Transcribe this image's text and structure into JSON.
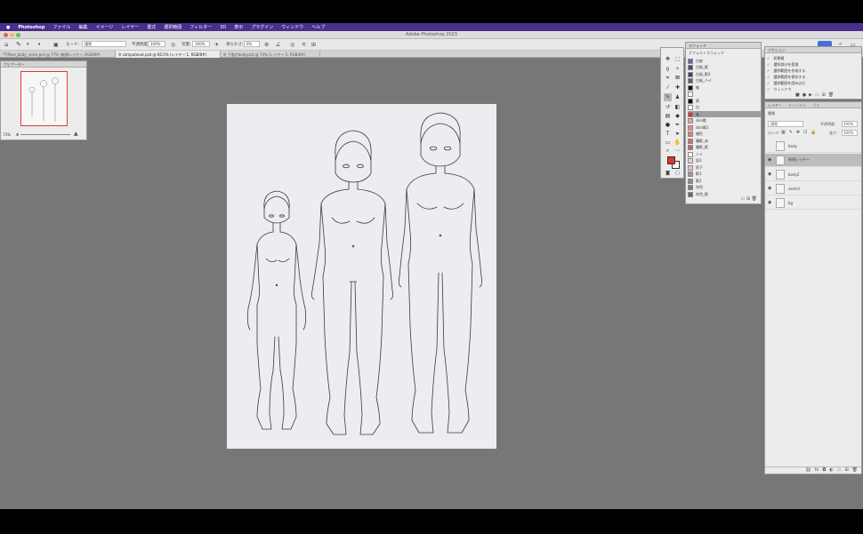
{
  "menubar": {
    "app_name": "Photoshop",
    "items": [
      "ファイル",
      "編集",
      "イメージ",
      "レイヤー",
      "書式",
      "選択範囲",
      "フィルター",
      "3D",
      "表示",
      "プラグイン",
      "ウィンドウ",
      "ヘルプ"
    ]
  },
  "window": {
    "title": "Adobe Photoshop 2023"
  },
  "options": {
    "mode_label": "モード:",
    "mode_value": "通常",
    "opacity_label": "不透明度:",
    "opacity_value": "100%",
    "flow_label": "流量:",
    "flow_value": "100%",
    "smoothing_label": "滑らかさ:",
    "smoothing_value": "0%"
  },
  "tabs": [
    {
      "label": "*T-Pose_body_noise.psd @ 77% (新規レイヤー, RGB/8#)"
    },
    {
      "label": "※ computeout.psd @ 66.5% (レイヤー 1, RGB/8#)"
    },
    {
      "label": "※ 下描きbody.psd @ 73% (レイヤー 1, RGB/8#)"
    }
  ],
  "navigator": {
    "header": "ナビゲーター",
    "zoom": "73%"
  },
  "swatches": {
    "header": "スウォッチ",
    "subheader": "デフォルトスウォッチ",
    "items": [
      {
        "name": "白桜",
        "color": "#6e6a9e"
      },
      {
        "name": "白桜_影",
        "color": "#4d4a7a"
      },
      {
        "name": "白桜_影2",
        "color": "#444466"
      },
      {
        "name": "白桜_ハイ",
        "color": "#5a5a84"
      },
      {
        "name": "線",
        "color": "#111111"
      },
      {
        "name": "",
        "color": "#ffffff"
      },
      {
        "name": "黒",
        "color": "#000000"
      },
      {
        "name": "白",
        "color": "#ffffff"
      },
      {
        "name": "赤",
        "color": "#e53030"
      },
      {
        "name": "skin影",
        "color": "#f0a0a0"
      },
      {
        "name": "skin影2",
        "color": "#ec8a8a"
      },
      {
        "name": "頬色",
        "color": "#e87878"
      },
      {
        "name": "瞳影_赤",
        "color": "#d86a6a"
      },
      {
        "name": "瞳影_影",
        "color": "#c86464"
      },
      {
        "name": "ハイ",
        "color": "#f4f4f4"
      },
      {
        "name": "肌1",
        "color": "#f2d4cc"
      },
      {
        "name": "肌下",
        "color": "#eec4bc"
      },
      {
        "name": "影1",
        "color": "#9a9a9a"
      },
      {
        "name": "影2",
        "color": "#8a8a8a"
      },
      {
        "name": "灰色",
        "color": "#7a7a7a"
      },
      {
        "name": "灰色_影",
        "color": "#6a6a6a"
      }
    ]
  },
  "actions": {
    "header": "アクション",
    "items": [
      "初期値",
      "選択部分を変換",
      "選択範囲を作成する",
      "選択範囲を保存する",
      "選択範囲を読み込む",
      "ウィンドウ"
    ]
  },
  "layers": {
    "header": "レイヤー",
    "tab2": "チャンネル",
    "tab3": "パス",
    "kind_label": "種類",
    "blend_mode": "通常",
    "opacity_label": "不透明度:",
    "opacity_value": "100%",
    "fill_label": "塗り:",
    "fill_value": "100%",
    "lock_label": "ロック:",
    "items": [
      {
        "name": "body",
        "visible": false,
        "selected": false
      },
      {
        "name": "新規レイヤー",
        "visible": true,
        "selected": true
      },
      {
        "name": "body2",
        "visible": true,
        "selected": false
      },
      {
        "name": "sketch",
        "visible": true,
        "selected": false
      },
      {
        "name": "bg",
        "visible": true,
        "selected": false
      }
    ]
  },
  "colors": {
    "foreground": "#e53030",
    "background": "#ffffff",
    "menubar": "#4a2e8c",
    "canvas": "#eeecf0",
    "workspace": "#777777"
  }
}
